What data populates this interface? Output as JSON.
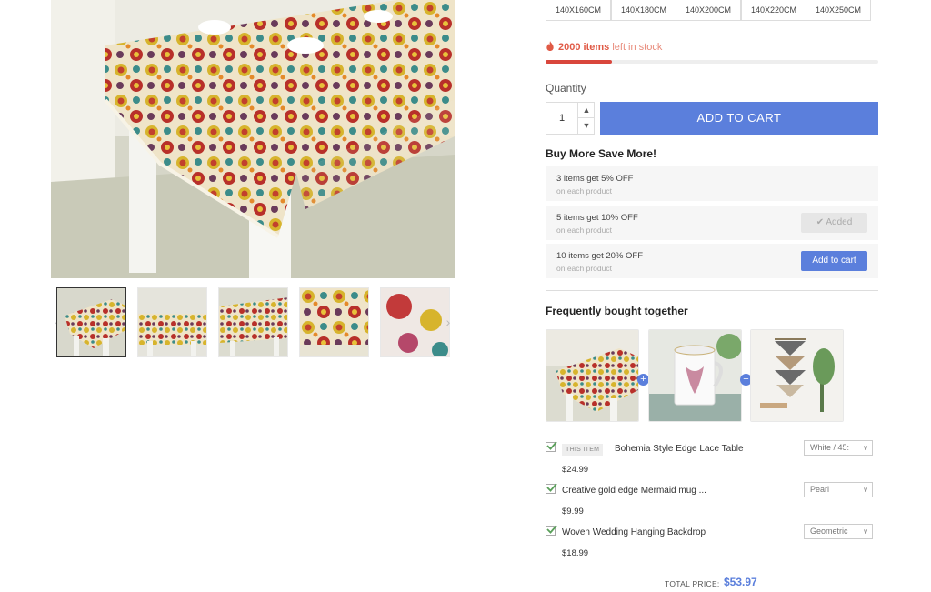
{
  "variants": [
    "140X160CM",
    "140X180CM",
    "140X200CM",
    "140X220CM",
    "140X250CM"
  ],
  "stock": {
    "count_text": "2000 items",
    "rest_text": "left in stock",
    "level": 0.2
  },
  "quantity": {
    "label": "Quantity",
    "value": "1"
  },
  "add_to_cart_label": "ADD TO CART",
  "bmsm": {
    "title": "Buy More Save More!",
    "tiers": [
      {
        "name": "3 items get 5% OFF",
        "sub": "on each product",
        "action": ""
      },
      {
        "name": "5 items get 10% OFF",
        "sub": "on each product",
        "action": "Added"
      },
      {
        "name": "10 items get 20% OFF",
        "sub": "on each product",
        "action": "Add to cart"
      }
    ]
  },
  "fbt": {
    "title": "Frequently bought together",
    "this_item_badge": "THIS ITEM",
    "items": [
      {
        "name": "Bohemia Style Edge Lace Table",
        "price": "$24.99",
        "option": "White / 45:"
      },
      {
        "name": "Creative gold edge Mermaid mug ...",
        "price": "$9.99",
        "option": "Pearl"
      },
      {
        "name": "Woven Wedding Hanging Backdrop",
        "price": "$18.99",
        "option": "Geometric"
      }
    ],
    "total_label": "TOTAL PRICE:",
    "total_value": "$53.97"
  },
  "colors": {
    "accent": "#5b7fdc",
    "stock_red": "#e05a46"
  }
}
